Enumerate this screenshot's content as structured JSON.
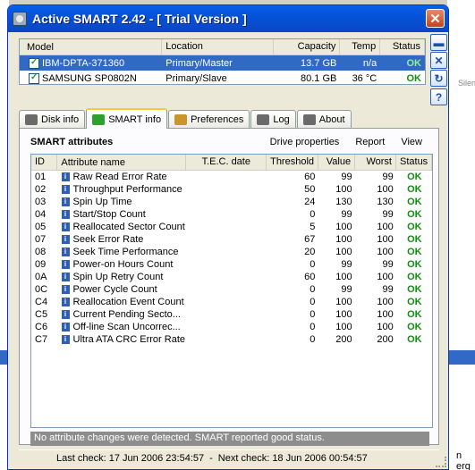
{
  "window": {
    "title": "Active SMART 2.42 - [ Trial Version ]"
  },
  "background": {
    "right_text_1": "Silenti",
    "right_text_2": "n erg"
  },
  "drives": {
    "headers": [
      "Model",
      "Location",
      "Capacity",
      "Temp",
      "Status"
    ],
    "rows": [
      {
        "model": "IBM-DPTA-371360",
        "location": "Primary/Master",
        "capacity": "13.7 GB",
        "temp": "n/a",
        "status": "OK",
        "selected": true
      },
      {
        "model": "SAMSUNG SP0802N",
        "location": "Primary/Slave",
        "capacity": "80.1 GB",
        "temp": "36 °C",
        "status": "OK",
        "selected": false
      }
    ]
  },
  "side_buttons": [
    "minimize-icon",
    "close-x-icon",
    "refresh-icon",
    "help-icon"
  ],
  "side_button_glyphs": [
    "▬",
    "✕",
    "↻",
    "?"
  ],
  "tabs": [
    {
      "label": "Disk info",
      "icon": "disk-icon",
      "color": "#6a6a6a"
    },
    {
      "label": "SMART info",
      "icon": "smart-check-icon",
      "color": "#2ea02e"
    },
    {
      "label": "Preferences",
      "icon": "gear-icon",
      "color": "#c8962d"
    },
    {
      "label": "Log",
      "icon": "log-check-icon",
      "color": "#6a6a6a"
    },
    {
      "label": "About",
      "icon": "about-question-icon",
      "color": "#6a6a6a"
    }
  ],
  "active_tab": 1,
  "smart": {
    "title": "SMART attributes",
    "links": [
      "Drive properties",
      "Report",
      "View"
    ],
    "headers": [
      "ID",
      "Attribute name",
      "T.E.C. date",
      "Threshold",
      "Value",
      "Worst",
      "Status"
    ],
    "rows": [
      {
        "id": "01",
        "name": "Raw Read Error Rate",
        "tec": "",
        "threshold": "60",
        "value": "99",
        "worst": "99",
        "status": "OK"
      },
      {
        "id": "02",
        "name": "Throughput Performance",
        "tec": "",
        "threshold": "50",
        "value": "100",
        "worst": "100",
        "status": "OK"
      },
      {
        "id": "03",
        "name": "Spin Up Time",
        "tec": "",
        "threshold": "24",
        "value": "130",
        "worst": "130",
        "status": "OK"
      },
      {
        "id": "04",
        "name": "Start/Stop Count",
        "tec": "",
        "threshold": "0",
        "value": "99",
        "worst": "99",
        "status": "OK"
      },
      {
        "id": "05",
        "name": "Reallocated Sector Count",
        "tec": "",
        "threshold": "5",
        "value": "100",
        "worst": "100",
        "status": "OK"
      },
      {
        "id": "07",
        "name": "Seek Error Rate",
        "tec": "",
        "threshold": "67",
        "value": "100",
        "worst": "100",
        "status": "OK"
      },
      {
        "id": "08",
        "name": "Seek Time Performance",
        "tec": "",
        "threshold": "20",
        "value": "100",
        "worst": "100",
        "status": "OK"
      },
      {
        "id": "09",
        "name": "Power-on Hours Count",
        "tec": "",
        "threshold": "0",
        "value": "99",
        "worst": "99",
        "status": "OK"
      },
      {
        "id": "0A",
        "name": "Spin Up Retry Count",
        "tec": "",
        "threshold": "60",
        "value": "100",
        "worst": "100",
        "status": "OK"
      },
      {
        "id": "0C",
        "name": "Power Cycle Count",
        "tec": "",
        "threshold": "0",
        "value": "99",
        "worst": "99",
        "status": "OK"
      },
      {
        "id": "C4",
        "name": "Reallocation Event Count",
        "tec": "",
        "threshold": "0",
        "value": "100",
        "worst": "100",
        "status": "OK"
      },
      {
        "id": "C5",
        "name": "Current Pending Secto...",
        "tec": "",
        "threshold": "0",
        "value": "100",
        "worst": "100",
        "status": "OK"
      },
      {
        "id": "C6",
        "name": "Off-line Scan Uncorrec...",
        "tec": "",
        "threshold": "0",
        "value": "100",
        "worst": "100",
        "status": "OK"
      },
      {
        "id": "C7",
        "name": "Ultra ATA CRC Error Rate",
        "tec": "",
        "threshold": "0",
        "value": "200",
        "worst": "200",
        "status": "OK"
      }
    ],
    "status_message": "No attribute changes were detected. SMART reported good status."
  },
  "footer": {
    "last_check": "Last check: 17 Jun 2006   23:54:57",
    "separator": "-",
    "next_check": "Next check: 18 Jun 2006   00:54:57"
  },
  "colors": {
    "ok": "#109010",
    "selection": "#316ac5",
    "titlebar": "#0553d9"
  }
}
